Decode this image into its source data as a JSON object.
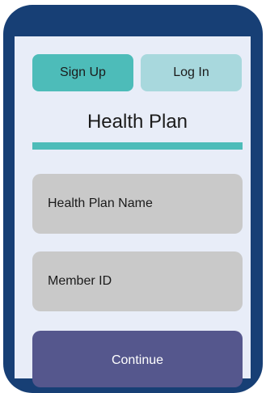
{
  "tabs": {
    "signup_label": "Sign Up",
    "login_label": "Log In"
  },
  "page": {
    "title": "Health Plan"
  },
  "form": {
    "health_plan_name_placeholder": "Health Plan Name",
    "member_id_placeholder": "Member ID",
    "continue_label": "Continue"
  },
  "colors": {
    "device_frame": "#173f75",
    "screen_background": "#e8edf8",
    "accent_teal": "#4dbcb9",
    "tab_inactive": "#a8d8dd",
    "field_background": "#c9c9c9",
    "primary_button": "#55578d"
  }
}
